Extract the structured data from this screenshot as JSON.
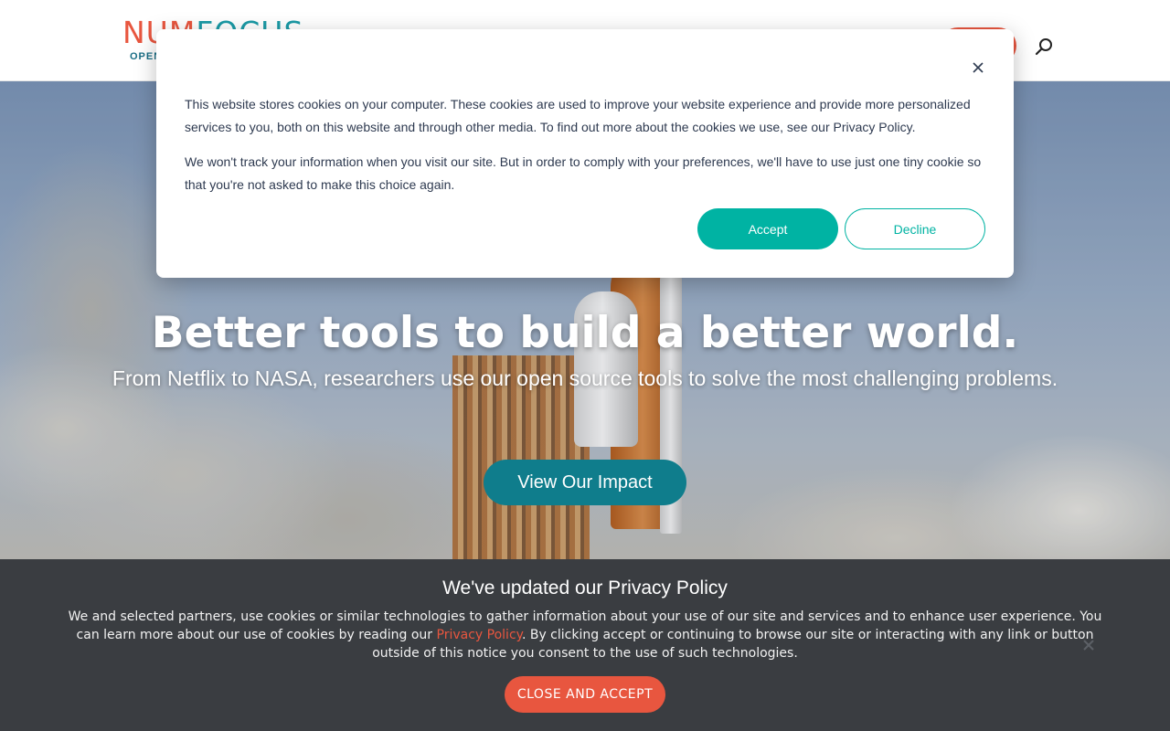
{
  "header": {
    "logo_part1": "NUM",
    "logo_part2": "FOCUS",
    "logo_tagline": "OPEN",
    "donate_label": "",
    "search_icon": "search-icon"
  },
  "hero": {
    "title": "Better tools to build a better world.",
    "subtitle": "From Netflix to NASA, researchers use our open source tools to solve the most challenging problems.",
    "cta_label": "View Our Impact"
  },
  "cookie_modal": {
    "paragraph1": "This website stores cookies on your computer. These cookies are used to improve your website experience and provide more personalized services to you, both on this website and through other media. To find out more about the cookies we use, see our Privacy Policy.",
    "paragraph2": "We won't track your information when you visit our site. But in order to comply with your preferences, we'll have to use just one tiny cookie so that you're not asked to make this choice again.",
    "accept_label": "Accept",
    "decline_label": "Decline",
    "close_icon": "close-icon"
  },
  "privacy_banner": {
    "title": "We've updated our Privacy Policy",
    "text_before_link": "We and selected partners, use cookies or similar technologies to gather information about your use of our site and services and to enhance user experience. You can learn more about our use of cookies by reading our ",
    "link_text": "Privacy Policy",
    "text_after_link": ". By clicking accept or continuing to browse our site or interacting with any link or button outside of this notice you consent to the use of such technologies.",
    "button_label": "CLOSE AND ACCEPT",
    "close_icon": "close-icon"
  },
  "colors": {
    "brand_orange": "#e8563f",
    "brand_teal": "#1b9aa6",
    "accept_teal": "#00b3a3",
    "impact_teal": "#0f7d8c",
    "banner_bg": "#3a3d41"
  }
}
